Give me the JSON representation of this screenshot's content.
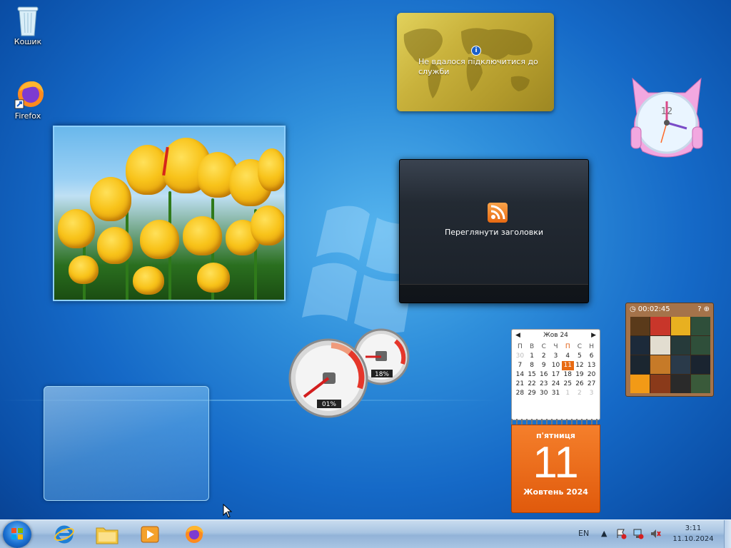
{
  "desktop": {
    "icons": [
      {
        "label": "Кошик",
        "icon": "recycle-bin-icon"
      },
      {
        "label": "Firefox",
        "icon": "firefox-icon"
      }
    ]
  },
  "gadgets": {
    "currency": {
      "message": "Не вдалося підключитися до служби",
      "icon": "info-icon"
    },
    "feed": {
      "label": "Переглянути заголовки",
      "icon": "rss-icon"
    },
    "clock": {
      "number": "12"
    },
    "cpu_meter": {
      "cpu_percent": "01%",
      "ram_percent": "18%"
    },
    "puzzle": {
      "timer": "00:02:45"
    },
    "calendar": {
      "month_header": "Жов 24",
      "weekdays": [
        "П",
        "В",
        "С",
        "Ч",
        "П",
        "С",
        "Н"
      ],
      "days": [
        "30",
        "1",
        "2",
        "3",
        "4",
        "5",
        "6",
        "7",
        "8",
        "9",
        "10",
        "11",
        "12",
        "13",
        "14",
        "15",
        "16",
        "17",
        "18",
        "19",
        "20",
        "21",
        "22",
        "23",
        "24",
        "25",
        "26",
        "27",
        "28",
        "29",
        "30",
        "31",
        "1",
        "2",
        "3"
      ],
      "weekday_name": "п'ятниця",
      "day_number": "11",
      "month_year": "Жовтень 2024"
    }
  },
  "taskbar": {
    "language": "EN",
    "time": "3:11",
    "date": "11.10.2024",
    "pinned": [
      "internet-explorer-icon",
      "file-explorer-icon",
      "media-player-icon",
      "firefox-icon"
    ]
  }
}
